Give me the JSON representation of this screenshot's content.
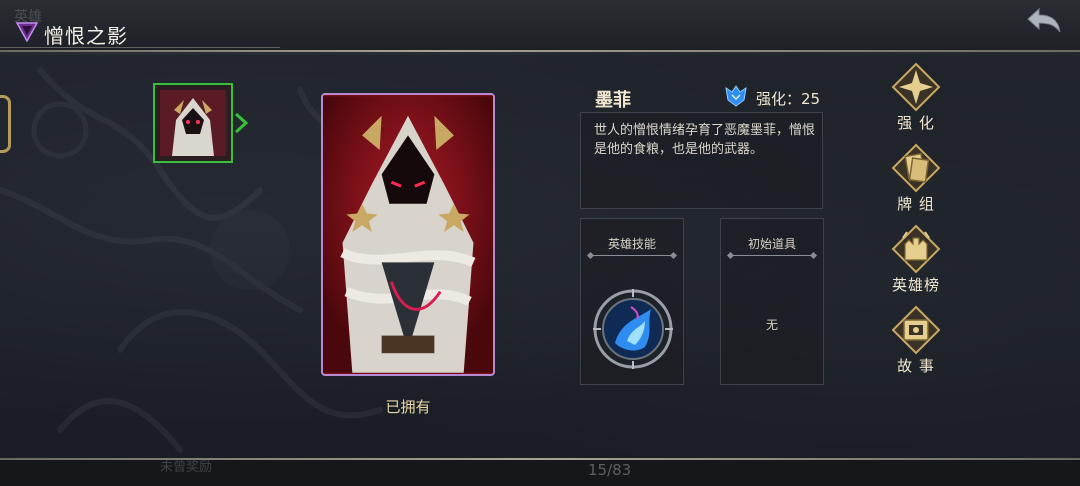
{
  "header": {
    "title": "憎恨之影",
    "ghost_tab": "英雄"
  },
  "hero": {
    "name": "墨菲",
    "enhance_label": "强化：25",
    "description": "世人的憎恨情绪孕育了恶魔墨菲，憎恨是他的食粮，也是他的武器。",
    "owned_label": "已拥有"
  },
  "sections": {
    "skill_title": "英雄技能",
    "items_title": "初始道具",
    "items_value": "无"
  },
  "menu": [
    {
      "label": "强 化",
      "icon": "compass-star-icon"
    },
    {
      "label": "牌 组",
      "icon": "card-deck-icon"
    },
    {
      "label": "英雄榜",
      "icon": "castle-crest-icon"
    },
    {
      "label": "故 事",
      "icon": "scroll-book-icon"
    }
  ],
  "footer": {
    "counter": "15/83",
    "ghost_label": "未曾奖励"
  },
  "colors": {
    "gold": "#c9a864",
    "select_green": "#35c23a",
    "card_border": "#b58ad0",
    "card_red": "#7a0f18",
    "skill_blue": "#2f8cf0"
  }
}
